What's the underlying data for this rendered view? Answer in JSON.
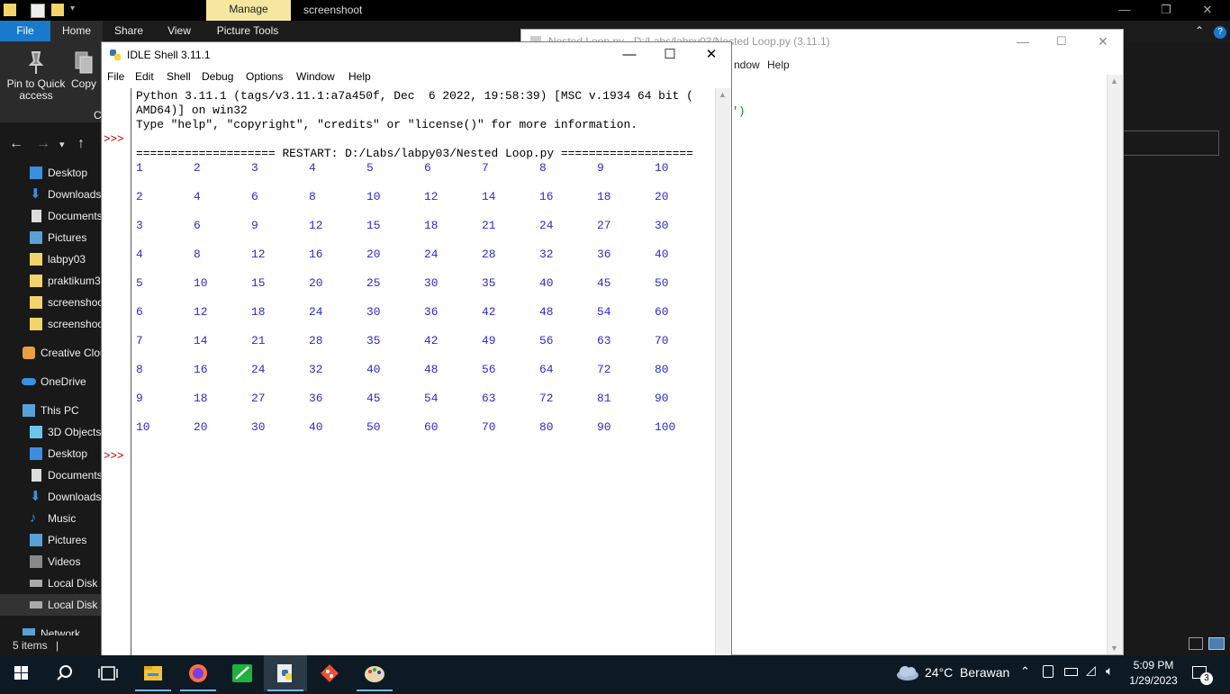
{
  "explorer": {
    "manage_label": "Manage",
    "title": "screenshoot",
    "tabs": [
      "File",
      "Home",
      "Share",
      "View",
      "Picture Tools"
    ],
    "ribbon": {
      "pin_label_1": "Pin to Quick",
      "pin_label_2": "access",
      "copy_label": "Copy",
      "cut_fragment": "C"
    },
    "sidebar": [
      {
        "label": "Desktop",
        "icon": "desktop-icon"
      },
      {
        "label": "Downloads",
        "icon": "download-icon"
      },
      {
        "label": "Documents",
        "icon": "document-icon"
      },
      {
        "label": "Pictures",
        "icon": "pictures-icon"
      },
      {
        "label": "labpy03",
        "icon": "folder-icon"
      },
      {
        "label": "praktikum3",
        "icon": "folder-icon"
      },
      {
        "label": "screenshoot",
        "icon": "folder-icon"
      },
      {
        "label": "screenshoot",
        "icon": "folder-icon"
      },
      {
        "label": "Creative Cloud",
        "icon": "creative-cloud-icon"
      },
      {
        "label": "OneDrive",
        "icon": "onedrive-icon"
      },
      {
        "label": "This PC",
        "icon": "pc-icon"
      },
      {
        "label": "3D Objects",
        "icon": "3d-objects-icon"
      },
      {
        "label": "Desktop",
        "icon": "desktop-icon"
      },
      {
        "label": "Documents",
        "icon": "document-icon"
      },
      {
        "label": "Downloads",
        "icon": "download-icon"
      },
      {
        "label": "Music",
        "icon": "music-icon"
      },
      {
        "label": "Pictures",
        "icon": "pictures-icon"
      },
      {
        "label": "Videos",
        "icon": "videos-icon"
      },
      {
        "label": "Local Disk (C:)",
        "icon": "disk-icon"
      },
      {
        "label": "Local Disk (D:)",
        "icon": "disk-icon"
      },
      {
        "label": "Network",
        "icon": "network-icon"
      }
    ],
    "status": "5 items"
  },
  "editor": {
    "title": "Nested Loop.py - D:/Labs/labpy03/Nested Loop.py (3.11.1)",
    "menu_window": "ndow",
    "menu_help": "Help",
    "code_fragment": "')"
  },
  "shell": {
    "title": "IDLE Shell 3.11.1",
    "menu": [
      "File",
      "Edit",
      "Shell",
      "Debug",
      "Options",
      "Window",
      "Help"
    ],
    "banner_1": "Python 3.11.1 (tags/v3.11.1:a7a450f, Dec  6 2022, 19:58:39) [MSC v.1934 64 bit (",
    "banner_2": "AMD64)] on win32",
    "banner_3": "Type \"help\", \"copyright\", \"credits\" or \"license()\" for more information.",
    "restart": "==================== RESTART: D:/Labs/labpy03/Nested Loop.py ===================",
    "prompt": ">>>",
    "table": [
      [
        1,
        2,
        3,
        4,
        5,
        6,
        7,
        8,
        9,
        10
      ],
      [
        2,
        4,
        6,
        8,
        10,
        12,
        14,
        16,
        18,
        20
      ],
      [
        3,
        6,
        9,
        12,
        15,
        18,
        21,
        24,
        27,
        30
      ],
      [
        4,
        8,
        12,
        16,
        20,
        24,
        28,
        32,
        36,
        40
      ],
      [
        5,
        10,
        15,
        20,
        25,
        30,
        35,
        40,
        45,
        50
      ],
      [
        6,
        12,
        18,
        24,
        30,
        36,
        42,
        48,
        54,
        60
      ],
      [
        7,
        14,
        21,
        28,
        35,
        42,
        49,
        56,
        63,
        70
      ],
      [
        8,
        16,
        24,
        32,
        40,
        48,
        56,
        64,
        72,
        80
      ],
      [
        9,
        18,
        27,
        36,
        45,
        54,
        63,
        72,
        81,
        90
      ],
      [
        10,
        20,
        30,
        40,
        50,
        60,
        70,
        80,
        90,
        100
      ]
    ]
  },
  "taskbar": {
    "weather": "24°C  Berawan",
    "time": "5:09 PM",
    "date": "1/29/2023",
    "notifications": "3"
  }
}
